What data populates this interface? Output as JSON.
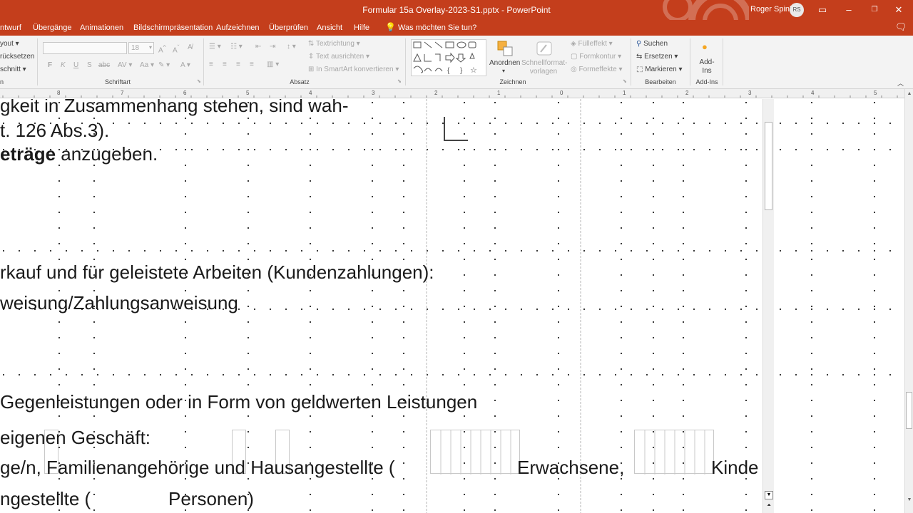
{
  "window": {
    "title": "Formular 15a Overlay-2023-S1.pptx  -  PowerPoint",
    "user_name": "Roger Spink",
    "user_initials": "RS"
  },
  "menu": {
    "tabs": [
      "ntwurf",
      "Übergänge",
      "Animationen",
      "Bildschirmpräsentation",
      "Aufzeichnen",
      "Überprüfen",
      "Ansicht",
      "Hilfe"
    ],
    "tell_me": "Was möchten Sie tun?"
  },
  "ribbon": {
    "slides": {
      "layout": "yout",
      "reset": "rücksetzen",
      "section": "schnitt"
    },
    "font": {
      "size": "18",
      "group_label": "Schriftart"
    },
    "paragraph": {
      "group_label": "Absatz",
      "text_direction": "Textrichtung",
      "align_text": "Text ausrichten",
      "smartart": "In SmartArt konvertieren"
    },
    "drawing": {
      "group_label": "Zeichnen",
      "arrange": "Anordnen",
      "quick_styles": "Schnellformat-vorlagen",
      "fill": "Fülleffekt",
      "outline": "Formkontur",
      "effects": "Formeffekte"
    },
    "editing": {
      "group_label": "Bearbeiten",
      "find": "Suchen",
      "replace": "Ersetzen",
      "select": "Markieren"
    },
    "addins": {
      "label": "Add-Ins",
      "group_label": "Add-Ins"
    }
  },
  "ruler": {
    "labels": [
      "8",
      "7",
      "6",
      "5",
      "4",
      "3",
      "2",
      "1",
      "0",
      "1",
      "2",
      "3",
      "4",
      "5"
    ]
  },
  "document": {
    "lines": [
      "gkeit in Zusammenhang stehen, sind wah-",
      "t. 126 Abs.3).",
      "eträge anzugeben.",
      "rkauf und für geleistete Arbeiten (Kundenzahlungen):",
      "weisung/Zahlungsanweisung",
      "Gegenleistungen oder in Form von geldwerten Leistungen",
      "eigenen Geschäft:",
      "ge/n, Familienangehörige und Hausangestellte (",
      "Erwachsene,",
      "Kinde",
      "ngestellte (",
      "Personen)"
    ],
    "bold_prefix": "eträge",
    "rest_after_bold": " anzugeben."
  }
}
